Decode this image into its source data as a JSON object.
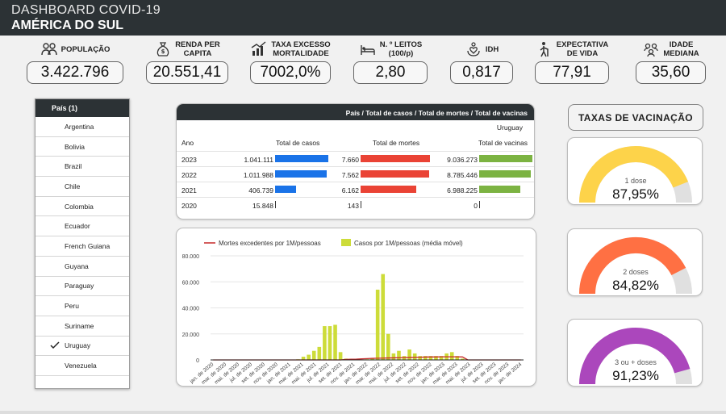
{
  "header": {
    "title": "DASHBOARD COVID-19",
    "subtitle": "AMÉRICA DO SUL"
  },
  "kpis": [
    {
      "label1": "POPULAÇÃO",
      "label2": "",
      "value": "3.422.796",
      "icon": "people-icon"
    },
    {
      "label1": "RENDA PER",
      "label2": "CAPITA",
      "value": "20.551,41",
      "icon": "money-bag-icon"
    },
    {
      "label1": "TAXA EXCESSO",
      "label2": "MORTALIDADE",
      "value": "7002,0%",
      "icon": "trend-chart-icon"
    },
    {
      "label1": "N. º LEITOS",
      "label2": "(100/p)",
      "value": "2,80",
      "icon": "hospital-bed-icon"
    },
    {
      "label1": "IDH",
      "label2": "",
      "value": "0,817",
      "icon": "hand-heart-icon"
    },
    {
      "label1": "EXPECTATIVA",
      "label2": "DE VIDA",
      "value": "77,91",
      "icon": "elder-person-icon"
    },
    {
      "label1": "IDADE",
      "label2": "MEDIANA",
      "value": "35,60",
      "icon": "group-icon"
    }
  ],
  "filter": {
    "header": "País (1)",
    "items": [
      "Argentina",
      "Bolivia",
      "Brazil",
      "Chile",
      "Colombia",
      "Ecuador",
      "French Guiana",
      "Guyana",
      "Paraguay",
      "Peru",
      "Suriname",
      "Uruguay",
      "Venezuela"
    ],
    "selected": "Uruguay"
  },
  "table": {
    "header": "País / Total de casos / Total de mortes / Total de vacinas",
    "country": "Uruguay",
    "columns": [
      "Ano",
      "Total de casos",
      "Total de mortes",
      "Total de vacinas"
    ],
    "rows": [
      {
        "year": "2023",
        "cases": "1.041.111",
        "cases_v": 1041111,
        "deaths": "7.660",
        "deaths_v": 7660,
        "vacc": "9.036.273",
        "vacc_v": 9036273
      },
      {
        "year": "2022",
        "cases": "1.011.988",
        "cases_v": 1011988,
        "deaths": "7.562",
        "deaths_v": 7562,
        "vacc": "8.785.446",
        "vacc_v": 8785446
      },
      {
        "year": "2021",
        "cases": "406.739",
        "cases_v": 406739,
        "deaths": "6.162",
        "deaths_v": 6162,
        "vacc": "6.988.225",
        "vacc_v": 6988225
      },
      {
        "year": "2020",
        "cases": "15.848",
        "cases_v": 15848,
        "deaths": "143",
        "deaths_v": 143,
        "vacc": "0",
        "vacc_v": 0
      }
    ],
    "colors": {
      "cases": "#1a73e8",
      "deaths": "#ea4335",
      "vacc": "#7cb342"
    }
  },
  "chart_data": {
    "type": "bar",
    "series": [
      {
        "name": "Mortes excedentes por 1M/pessoas",
        "kind": "line",
        "color": "#c62828",
        "values": [
          0,
          0,
          0,
          0,
          0,
          0,
          0,
          0,
          0,
          0,
          0,
          0,
          0,
          0,
          0,
          0,
          0,
          0,
          0,
          0,
          0,
          0,
          0,
          0,
          0,
          400,
          500,
          600,
          800,
          1000,
          1200,
          1300,
          1400,
          1500,
          1600,
          1700,
          1800,
          1900,
          2000,
          2100,
          2200,
          2300,
          2300,
          2400,
          2400,
          2400,
          2400,
          2300,
          0,
          0,
          0,
          0,
          0,
          0,
          0,
          0,
          0,
          0,
          0
        ]
      },
      {
        "name": "Casos por 1M/pessoas (média móvel)",
        "kind": "bar",
        "color": "#cddc39",
        "values": [
          0,
          0,
          0,
          0,
          0,
          0,
          0,
          0,
          0,
          0,
          0,
          0,
          0,
          0,
          0,
          0,
          500,
          2500,
          4000,
          7000,
          10000,
          26000,
          26000,
          27000,
          6000,
          1000,
          500,
          300,
          200,
          500,
          1000,
          54000,
          66000,
          20000,
          5000,
          7000,
          3000,
          8000,
          5000,
          3000,
          3000,
          3000,
          3000,
          3000,
          5000,
          6000,
          3000,
          1000,
          0,
          0,
          0,
          0,
          0,
          0,
          0,
          0,
          0,
          0,
          0
        ]
      }
    ],
    "yticks": [
      "80.000",
      "60.000",
      "40.000",
      "20.000",
      "0"
    ],
    "ylim": [
      0,
      80000
    ],
    "xticks": [
      "jan. de 2020",
      "mar. de 2020",
      "mai. de 2020",
      "jul. de 2020",
      "set. de 2020",
      "nov. de 2020",
      "jan. de 2021",
      "mar. de 2021",
      "mai. de 2021",
      "jul. de 2021",
      "set. de 2021",
      "nov. de 2021",
      "jan. de 2022",
      "mar. de 2022",
      "mai. de 2022",
      "jul. de 2022",
      "set. de 2022",
      "nov. de 2022",
      "jan. de 2023",
      "mar. de 2023",
      "mai. de 2023",
      "jul. de 2023",
      "set. de 2023",
      "nov. de 2023",
      "jan. de 2024"
    ],
    "legend": "top"
  },
  "vaccination": {
    "title": "TAXAS DE VACINAÇÃO",
    "gauges": [
      {
        "label": "1 dose",
        "value": "87,95%",
        "pct": 87.95,
        "color": "#fdd34a"
      },
      {
        "label": "2 doses",
        "value": "84,82%",
        "pct": 84.82,
        "color": "#ff7043"
      },
      {
        "label": "3 ou + doses",
        "value": "91,23%",
        "pct": 91.23,
        "color": "#ab47bc"
      }
    ]
  }
}
